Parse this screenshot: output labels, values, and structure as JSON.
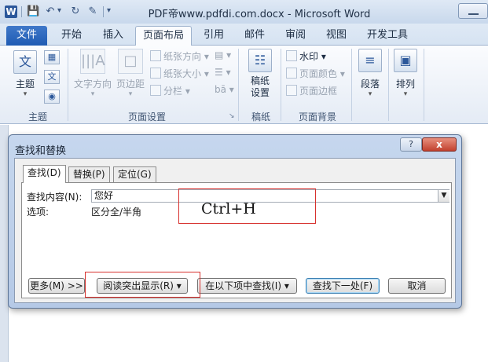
{
  "window": {
    "app_icon": "W",
    "title": "PDF帝www.pdfdi.com.docx - Microsoft Word"
  },
  "qat": {
    "icons": [
      "save-icon",
      "undo-icon",
      "redo-icon",
      "format-painter-icon",
      "customize-dropdown-icon"
    ]
  },
  "ribbon_tabs": [
    "文件",
    "开始",
    "插入",
    "页面布局",
    "引用",
    "邮件",
    "审阅",
    "视图",
    "开发工具"
  ],
  "ribbon": {
    "theme_group": {
      "label": "主题",
      "theme_button": "主题"
    },
    "page_setup_group": {
      "label": "页面设置",
      "text_direction": "文字方向",
      "margins": "页边距",
      "orientation": "纸张方向",
      "size": "纸张大小",
      "columns": "分栏"
    },
    "manuscript_group": {
      "label": "稿纸",
      "manuscript_button_line1": "稿纸",
      "manuscript_button_line2": "设置"
    },
    "page_background_group": {
      "label": "页面背景",
      "watermark": "水印",
      "page_color": "页面颜色",
      "page_borders": "页面边框"
    },
    "paragraph_button": "段落",
    "arrange_button": "排列"
  },
  "dialog": {
    "title": "查找和替换",
    "help": "?",
    "close": "x",
    "tabs": [
      "查找(D)",
      "替换(P)",
      "定位(G)"
    ],
    "find_label": "查找内容(N):",
    "find_value": "您好",
    "options_label": "选项:",
    "options_value": "区分全/半角",
    "buttons": {
      "more": "更多(M) >>",
      "reading_highlight": "阅读突出显示(R)",
      "find_in": "在以下项中查找(I)",
      "find_next": "查找下一处(F)",
      "cancel": "取消"
    }
  },
  "annotation": {
    "shortcut": "Ctrl+H"
  }
}
